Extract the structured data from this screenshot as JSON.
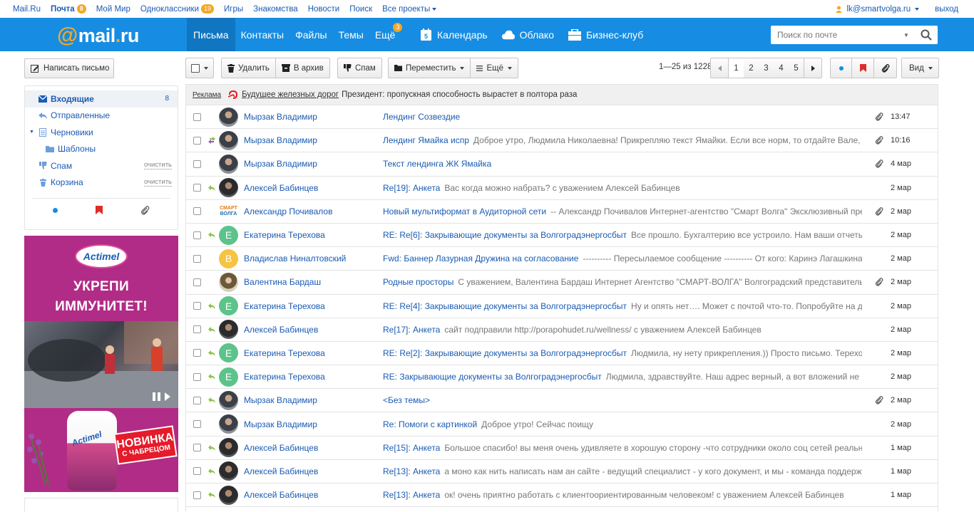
{
  "portal": {
    "items": [
      {
        "label": "Mail.Ru",
        "bold": false
      },
      {
        "label": "Почта",
        "bold": true,
        "badge": "8"
      },
      {
        "label": "Мой Мир",
        "bold": false
      },
      {
        "label": "Одноклассники",
        "bold": false,
        "badge": "19"
      },
      {
        "label": "Игры",
        "bold": false
      },
      {
        "label": "Знакомства",
        "bold": false
      },
      {
        "label": "Новости",
        "bold": false
      },
      {
        "label": "Поиск",
        "bold": false
      },
      {
        "label": "Все проекты",
        "bold": false
      }
    ],
    "user_email": "lk@smartvolga.ru",
    "logout": "выход"
  },
  "header": {
    "logo_at": "@",
    "logo_main": "mail",
    "logo_dot": ".",
    "logo_ru": "ru",
    "nav": [
      {
        "label": "Письма",
        "active": true
      },
      {
        "label": "Контакты"
      },
      {
        "label": "Файлы"
      },
      {
        "label": "Темы"
      },
      {
        "label": "Ещё",
        "badge": "3"
      }
    ],
    "nav2": [
      {
        "label": "Календарь",
        "icon": "calendar-icon",
        "icon_text": "5"
      },
      {
        "label": "Облако",
        "icon": "cloud-icon"
      },
      {
        "label": "Бизнес-клуб",
        "icon": "briefcase-icon"
      }
    ],
    "search_placeholder": "Поиск по почте"
  },
  "sidebar": {
    "compose_label": "Написать письмо",
    "folders": [
      {
        "label": "Входящие",
        "count": "8",
        "selected": true,
        "icon": "inbox-icon"
      },
      {
        "label": "Отправленные",
        "icon": "sent-icon"
      },
      {
        "label": "Черновики",
        "icon": "drafts-icon",
        "expanded": true
      },
      {
        "label": "Шаблоны",
        "icon": "folder-icon",
        "child": true
      },
      {
        "label": "Спам",
        "icon": "spam-icon",
        "clear": "очистить"
      },
      {
        "label": "Корзина",
        "icon": "trash-icon",
        "clear": "очистить"
      }
    ],
    "ad": {
      "brand": "Actimel",
      "headline_1": "УКРЕПИ",
      "headline_2": "ИММУНИТЕТ!",
      "new_1": "НОВИНКА",
      "new_2": "С ЧАБРЕЦОМ"
    }
  },
  "toolbar": {
    "delete": "Удалить",
    "archive": "В архив",
    "spam": "Спам",
    "move": "Переместить",
    "more": "Ещё",
    "range": "1—25 из 1228",
    "pages": [
      "1",
      "2",
      "3",
      "4",
      "5"
    ],
    "current_page": "1",
    "view": "Вид",
    "colors": {
      "unread_dot": "#168de2",
      "flag": "#e02b2b"
    }
  },
  "ad_row": {
    "label": "Реклама",
    "link": "Будущее железных дорог",
    "text": "Президент: пропускная способность вырастет в полтора раза"
  },
  "messages": [
    {
      "from": "Мырзак Владимир",
      "subject": "Лендинг Созвездие",
      "preview": "",
      "date": "13:47",
      "attach": true,
      "status": "",
      "avatar": "man1"
    },
    {
      "from": "Мырзак Владимир",
      "subject": "Лендинг Ямайка испр",
      "preview": "Доброе утро, Людмила Николаевна! Прикрепляю текст Ямайки. Если все норм, то отдайте Вале, чтобы",
      "date": "10:16",
      "attach": true,
      "status": "fwd",
      "avatar": "man1"
    },
    {
      "from": "Мырзак Владимир",
      "subject": "Текст лендинга ЖК Ямайка",
      "preview": "",
      "date": "4 мар",
      "attach": true,
      "status": "",
      "avatar": "man1"
    },
    {
      "from": "Алексей Бабинцев",
      "subject": "Re[19]: Анкета",
      "preview": "Вас когда можно набрать? с уважением Алексей Бабинцев",
      "date": "2 мар",
      "attach": false,
      "status": "reply",
      "avatar": "man2"
    },
    {
      "from": "Александр Почивалов",
      "subject": "Новый мультиформат в Аудиторной сети",
      "preview": "-- Александр Почивалов Интернет-агентство \"Смарт Волга\" Эксклюзивный представитель",
      "date": "2 мар",
      "attach": true,
      "status": "",
      "avatar": "smart"
    },
    {
      "from": "Екатерина Терехова",
      "subject": "RE: Re[6]: Закрывающие документы за Волгоградэнергосбыт",
      "preview": "Все прошло. Бухгалтерию все устроило. Нам ваши отчеты не нужны",
      "date": "2 мар",
      "attach": false,
      "status": "reply",
      "avatar": "green",
      "initial": "Е"
    },
    {
      "from": "Владислав Ниналтовский",
      "subject": "Fwd: Баннер Лазурная Дружина на согласование",
      "preview": "---------- Пересылаемое сообщение ---------- От кого: Каринэ Лагашкина <lagashkina",
      "date": "2 мар",
      "attach": false,
      "status": "",
      "avatar": "yellow",
      "initial": "В"
    },
    {
      "from": "Валентина Бардаш",
      "subject": "Родные просторы",
      "preview": "С уважением, Валентина Бардаш Интернет Агентство \"СМАРТ-ВОЛГА\" Волгоградский представитель Mail.Ru",
      "date": "2 мар",
      "attach": true,
      "status": "",
      "avatar": "woman"
    },
    {
      "from": "Екатерина Терехова",
      "subject": "RE: Re[4]: Закрывающие документы за Волгоградэнергосбыт",
      "preview": "Ну и опять нет…. Может с почтой что-то. Попробуйте на другую почту",
      "date": "2 мар",
      "attach": false,
      "status": "reply",
      "avatar": "green",
      "initial": "Е"
    },
    {
      "from": "Алексей Бабинцев",
      "subject": "Re[17]: Анкета",
      "preview": "сайт подправили http://porapohudet.ru/wellness/ с уважением Алексей Бабинцев",
      "date": "2 мар",
      "attach": false,
      "status": "reply",
      "avatar": "man2"
    },
    {
      "from": "Екатерина Терехова",
      "subject": "RE: Re[2]: Закрывающие документы за Волгоградэнергосбыт",
      "preview": "Людмила, ну нету прикрепления.)) Просто письмо. Терехова Екатерина",
      "date": "2 мар",
      "attach": false,
      "status": "reply",
      "avatar": "green",
      "initial": "Е"
    },
    {
      "from": "Екатерина Терехова",
      "subject": "RE: Закрывающие документы за Волгоградэнергосбыт",
      "preview": "Людмила, здравствуйте. Наш адрес верный, а вот вложений не видно",
      "date": "2 мар",
      "attach": false,
      "status": "reply",
      "avatar": "green",
      "initial": "Е"
    },
    {
      "from": "Мырзак Владимир",
      "subject": "<Без темы>",
      "preview": "",
      "date": "2 мар",
      "attach": true,
      "status": "reply",
      "avatar": "man1"
    },
    {
      "from": "Мырзак Владимир",
      "subject": "Re: Помоги с картинкой",
      "preview": "Доброе утро! Сейчас поищу",
      "date": "2 мар",
      "attach": false,
      "status": "",
      "avatar": "man1"
    },
    {
      "from": "Алексей Бабинцев",
      "subject": "Re[15]: Анкета",
      "preview": "Большое спасибо! вы меня очень удивляете в хорошую сторону -что сотрудники около соц сетей реально работают",
      "date": "1 мар",
      "attach": false,
      "status": "reply",
      "avatar": "man2"
    },
    {
      "from": "Алексей Бабинцев",
      "subject": "Re[13]: Анкета",
      "preview": "а моно как нить написать нам ан сайте - ведущий специалист - у кого документ, и мы - команда поддержки",
      "date": "1 мар",
      "attach": false,
      "status": "reply",
      "avatar": "man2"
    },
    {
      "from": "Алексей Бабинцев",
      "subject": "Re[13]: Анкета",
      "preview": "ок! очень приятно работать с клиентоориентированным человеком! с уважением Алексей Бабинцев",
      "date": "1 мар",
      "attach": false,
      "status": "reply",
      "avatar": "man2"
    }
  ]
}
